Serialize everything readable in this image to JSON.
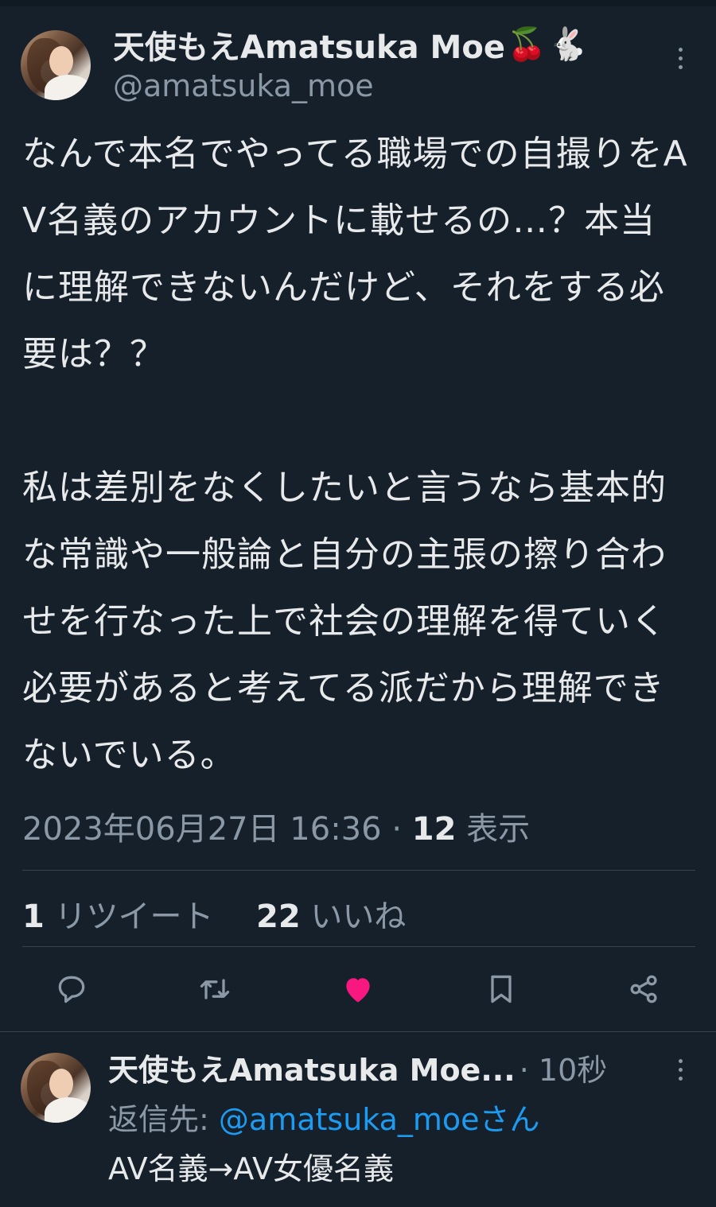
{
  "tweet": {
    "display_name": "天使もえAmatsuka Moe",
    "name_emoji": [
      "🍒",
      "🐇"
    ],
    "handle": "@amatsuka_moe",
    "text": "なんで本名でやってる職場での自撮りをAV名義のアカウントに載せるの…？本当に理解できないんだけど、それをする必要は？？\n\n私は差別をなくしたいと言うなら基本的な常識や一般論と自分の主張の擦り合わせを行なった上で社会の理解を得ていく必要があると考えてる派だから理解できないでいる。",
    "timestamp": "2023年06月27日 16:36",
    "views_count": "12",
    "views_label": "表示",
    "retweets_count": "1",
    "retweets_label": "リツイート",
    "likes_count": "22",
    "likes_label": "いいね"
  },
  "actions": {
    "reply_icon": "reply-icon",
    "retweet_icon": "retweet-icon",
    "like_icon": "heart-icon",
    "bookmark_icon": "bookmark-icon",
    "share_icon": "share-icon",
    "like_color": "#f91880",
    "icon_color": "#8b98a5"
  },
  "reply": {
    "display_name": "天使もえAmatsuka Moe...",
    "time": "10秒",
    "reply_to_label": "返信先:",
    "reply_to_handle": "@amatsuka_moeさん",
    "text": "AV名義→AV女優名義"
  },
  "colors": {
    "background": "#15202b",
    "text": "#e7e9ea",
    "secondary": "#8b98a5",
    "link": "#1d9bf0"
  }
}
